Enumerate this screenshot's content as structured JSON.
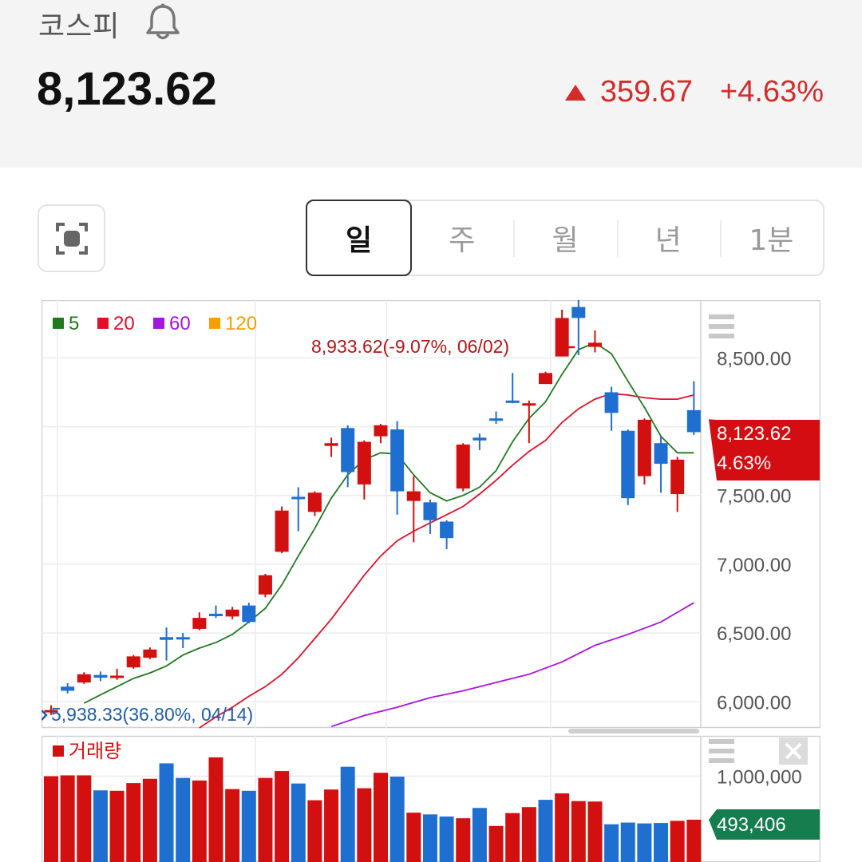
{
  "header": {
    "index_name": "코스피",
    "price": "8,123.62",
    "change": "359.67",
    "change_pct": "+4.63%"
  },
  "tabs": [
    {
      "label": "일",
      "active": true
    },
    {
      "label": "주",
      "active": false
    },
    {
      "label": "월",
      "active": false
    },
    {
      "label": "년",
      "active": false
    },
    {
      "label": "1분",
      "active": false
    }
  ],
  "colors": {
    "up": "#d31010",
    "down": "#1f6fd1",
    "ma5": "#1f7a1f",
    "ma20": "#e0102a",
    "ma60": "#a515e0",
    "ma120": "#f5a000",
    "volume_badge": "#167d4f"
  },
  "icons": [
    "bell-icon",
    "capture-icon",
    "menu-icon",
    "close-icon",
    "arrow-left-icon"
  ],
  "chart_data": [
    {
      "type": "candlestick",
      "title": "",
      "legend": [
        {
          "label": "5",
          "color": "#1f7a1f"
        },
        {
          "label": "20",
          "color": "#e0102a"
        },
        {
          "label": "60",
          "color": "#a515e0"
        },
        {
          "label": "120",
          "color": "#f5a000"
        }
      ],
      "y_ticks": [
        "8,500.00",
        "7,500.00",
        "7,000.00",
        "6,500.00",
        "6,000.00"
      ],
      "y_tick_values": [
        8500,
        7500,
        7000,
        6500,
        6000
      ],
      "ylim": [
        5810,
        8920
      ],
      "current": {
        "price": "8,123.62",
        "pct": "4.63%",
        "value": 8123.62
      },
      "high_annotation": "8,933.62(-9.07%, 06/02)",
      "low_annotation": "5,938.33(36.80%, 04/14)",
      "candles": [
        {
          "o": 5940,
          "c": 5940,
          "h": 5975,
          "l": 5905,
          "up": true
        },
        {
          "o": 6110,
          "c": 6080,
          "h": 6135,
          "l": 6060,
          "up": false
        },
        {
          "o": 6140,
          "c": 6200,
          "h": 6215,
          "l": 6130,
          "up": true
        },
        {
          "o": 6195,
          "c": 6175,
          "h": 6220,
          "l": 6150,
          "up": false
        },
        {
          "o": 6180,
          "c": 6190,
          "h": 6240,
          "l": 6160,
          "up": true
        },
        {
          "o": 6250,
          "c": 6330,
          "h": 6340,
          "l": 6240,
          "up": true
        },
        {
          "o": 6320,
          "c": 6380,
          "h": 6395,
          "l": 6310,
          "up": true
        },
        {
          "o": 6470,
          "c": 6450,
          "h": 6540,
          "l": 6300,
          "up": false
        },
        {
          "o": 6470,
          "c": 6460,
          "h": 6500,
          "l": 6390,
          "up": false
        },
        {
          "o": 6530,
          "c": 6610,
          "h": 6650,
          "l": 6520,
          "up": true
        },
        {
          "o": 6640,
          "c": 6630,
          "h": 6700,
          "l": 6610,
          "up": false
        },
        {
          "o": 6620,
          "c": 6670,
          "h": 6690,
          "l": 6600,
          "up": true
        },
        {
          "o": 6700,
          "c": 6580,
          "h": 6720,
          "l": 6570,
          "up": false
        },
        {
          "o": 6780,
          "c": 6920,
          "h": 6930,
          "l": 6760,
          "up": true
        },
        {
          "o": 7090,
          "c": 7390,
          "h": 7420,
          "l": 7080,
          "up": true
        },
        {
          "o": 7490,
          "c": 7480,
          "h": 7560,
          "l": 7240,
          "up": false
        },
        {
          "o": 7380,
          "c": 7520,
          "h": 7530,
          "l": 7350,
          "up": true
        },
        {
          "o": 7860,
          "c": 7880,
          "h": 7920,
          "l": 7780,
          "up": true
        },
        {
          "o": 7990,
          "c": 7670,
          "h": 8010,
          "l": 7560,
          "up": false
        },
        {
          "o": 7580,
          "c": 7890,
          "h": 7900,
          "l": 7470,
          "up": true
        },
        {
          "o": 7930,
          "c": 8010,
          "h": 8020,
          "l": 7880,
          "up": true
        },
        {
          "o": 7980,
          "c": 7530,
          "h": 8040,
          "l": 7360,
          "up": false
        },
        {
          "o": 7460,
          "c": 7530,
          "h": 7640,
          "l": 7160,
          "up": true
        },
        {
          "o": 7450,
          "c": 7320,
          "h": 7470,
          "l": 7220,
          "up": false
        },
        {
          "o": 7310,
          "c": 7190,
          "h": 7320,
          "l": 7110,
          "up": false
        },
        {
          "o": 7550,
          "c": 7870,
          "h": 7880,
          "l": 7530,
          "up": true
        },
        {
          "o": 7920,
          "c": 7900,
          "h": 7950,
          "l": 7830,
          "up": false
        },
        {
          "o": 8050,
          "c": 8060,
          "h": 8110,
          "l": 8020,
          "up": false
        },
        {
          "o": 8180,
          "c": 8190,
          "h": 8390,
          "l": 8170,
          "up": false
        },
        {
          "o": 8170,
          "c": 8160,
          "h": 8190,
          "l": 7880,
          "up": true
        },
        {
          "o": 8310,
          "c": 8390,
          "h": 8400,
          "l": 8310,
          "up": true
        },
        {
          "o": 8510,
          "c": 8790,
          "h": 8850,
          "l": 8510,
          "up": true
        },
        {
          "o": 8870,
          "c": 8790,
          "h": 8933,
          "l": 8520,
          "up": false
        },
        {
          "o": 8610,
          "c": 8580,
          "h": 8700,
          "l": 8540,
          "up": true
        },
        {
          "o": 8250,
          "c": 8100,
          "h": 8290,
          "l": 7970,
          "up": false
        },
        {
          "o": 7970,
          "c": 7480,
          "h": 7980,
          "l": 7430,
          "up": false
        },
        {
          "o": 7640,
          "c": 8050,
          "h": 8060,
          "l": 7580,
          "up": true
        },
        {
          "o": 7880,
          "c": 7730,
          "h": 7930,
          "l": 7520,
          "up": false
        },
        {
          "o": 7510,
          "c": 7760,
          "h": 7780,
          "l": 7380,
          "up": true
        },
        {
          "o": 7960,
          "c": 8120,
          "h": 8330,
          "l": 7940,
          "up": false
        }
      ],
      "ma5": [
        [
          2,
          5990
        ],
        [
          3,
          6050
        ],
        [
          4,
          6110
        ],
        [
          5,
          6170
        ],
        [
          6,
          6210
        ],
        [
          7,
          6260
        ],
        [
          8,
          6340
        ],
        [
          9,
          6390
        ],
        [
          10,
          6430
        ],
        [
          11,
          6490
        ],
        [
          12,
          6580
        ],
        [
          13,
          6680
        ],
        [
          14,
          6850
        ],
        [
          15,
          7060
        ],
        [
          16,
          7260
        ],
        [
          17,
          7480
        ],
        [
          18,
          7650
        ],
        [
          19,
          7760
        ],
        [
          20,
          7810
        ],
        [
          21,
          7800
        ],
        [
          22,
          7650
        ],
        [
          23,
          7520
        ],
        [
          24,
          7460
        ],
        [
          25,
          7500
        ],
        [
          26,
          7560
        ],
        [
          27,
          7680
        ],
        [
          28,
          7890
        ],
        [
          29,
          8060
        ],
        [
          30,
          8180
        ],
        [
          31,
          8380
        ],
        [
          32,
          8560
        ],
        [
          33,
          8610
        ],
        [
          34,
          8530
        ],
        [
          35,
          8330
        ],
        [
          36,
          8140
        ],
        [
          37,
          7930
        ],
        [
          38,
          7810
        ],
        [
          39,
          7810
        ]
      ],
      "ma20": [
        [
          9,
          5810
        ],
        [
          10,
          5890
        ],
        [
          11,
          5960
        ],
        [
          12,
          6040
        ],
        [
          13,
          6110
        ],
        [
          14,
          6200
        ],
        [
          15,
          6320
        ],
        [
          16,
          6460
        ],
        [
          17,
          6600
        ],
        [
          18,
          6760
        ],
        [
          19,
          6920
        ],
        [
          20,
          7060
        ],
        [
          21,
          7170
        ],
        [
          22,
          7240
        ],
        [
          23,
          7300
        ],
        [
          24,
          7360
        ],
        [
          25,
          7420
        ],
        [
          26,
          7510
        ],
        [
          27,
          7610
        ],
        [
          28,
          7720
        ],
        [
          29,
          7820
        ],
        [
          30,
          7900
        ],
        [
          31,
          8030
        ],
        [
          32,
          8130
        ],
        [
          33,
          8200
        ],
        [
          34,
          8240
        ],
        [
          35,
          8230
        ],
        [
          36,
          8210
        ],
        [
          37,
          8200
        ],
        [
          38,
          8200
        ],
        [
          39,
          8230
        ]
      ],
      "ma60": [
        [
          17,
          5820
        ],
        [
          19,
          5900
        ],
        [
          21,
          5960
        ],
        [
          23,
          6030
        ],
        [
          25,
          6080
        ],
        [
          27,
          6140
        ],
        [
          29,
          6200
        ],
        [
          31,
          6290
        ],
        [
          33,
          6410
        ],
        [
          35,
          6490
        ],
        [
          37,
          6580
        ],
        [
          39,
          6720
        ]
      ]
    },
    {
      "type": "bar",
      "legend": [
        {
          "label": "거래량",
          "color": "#d31010"
        }
      ],
      "y_ticks": [
        "1,000,000"
      ],
      "y_tick_values": [
        1000000
      ],
      "ylim": [
        0,
        1470000
      ],
      "current": {
        "label": "493,406",
        "value": 493406
      },
      "volumes": [
        1000000,
        1010000,
        1010000,
        835000,
        830000,
        920000,
        970000,
        1150000,
        980000,
        950000,
        1220000,
        850000,
        830000,
        980000,
        1060000,
        915000,
        720000,
        845000,
        1110000,
        860000,
        1040000,
        995000,
        575000,
        555000,
        530000,
        510000,
        630000,
        420000,
        570000,
        640000,
        725000,
        800000,
        710000,
        705000,
        440000,
        460000,
        450000,
        455000,
        480000,
        493406
      ],
      "up": [
        true,
        true,
        true,
        false,
        true,
        true,
        true,
        false,
        false,
        true,
        true,
        true,
        false,
        true,
        true,
        false,
        true,
        true,
        false,
        true,
        true,
        false,
        true,
        false,
        false,
        true,
        false,
        true,
        true,
        true,
        false,
        true,
        true,
        true,
        false,
        false,
        false,
        false,
        true,
        true
      ]
    }
  ]
}
